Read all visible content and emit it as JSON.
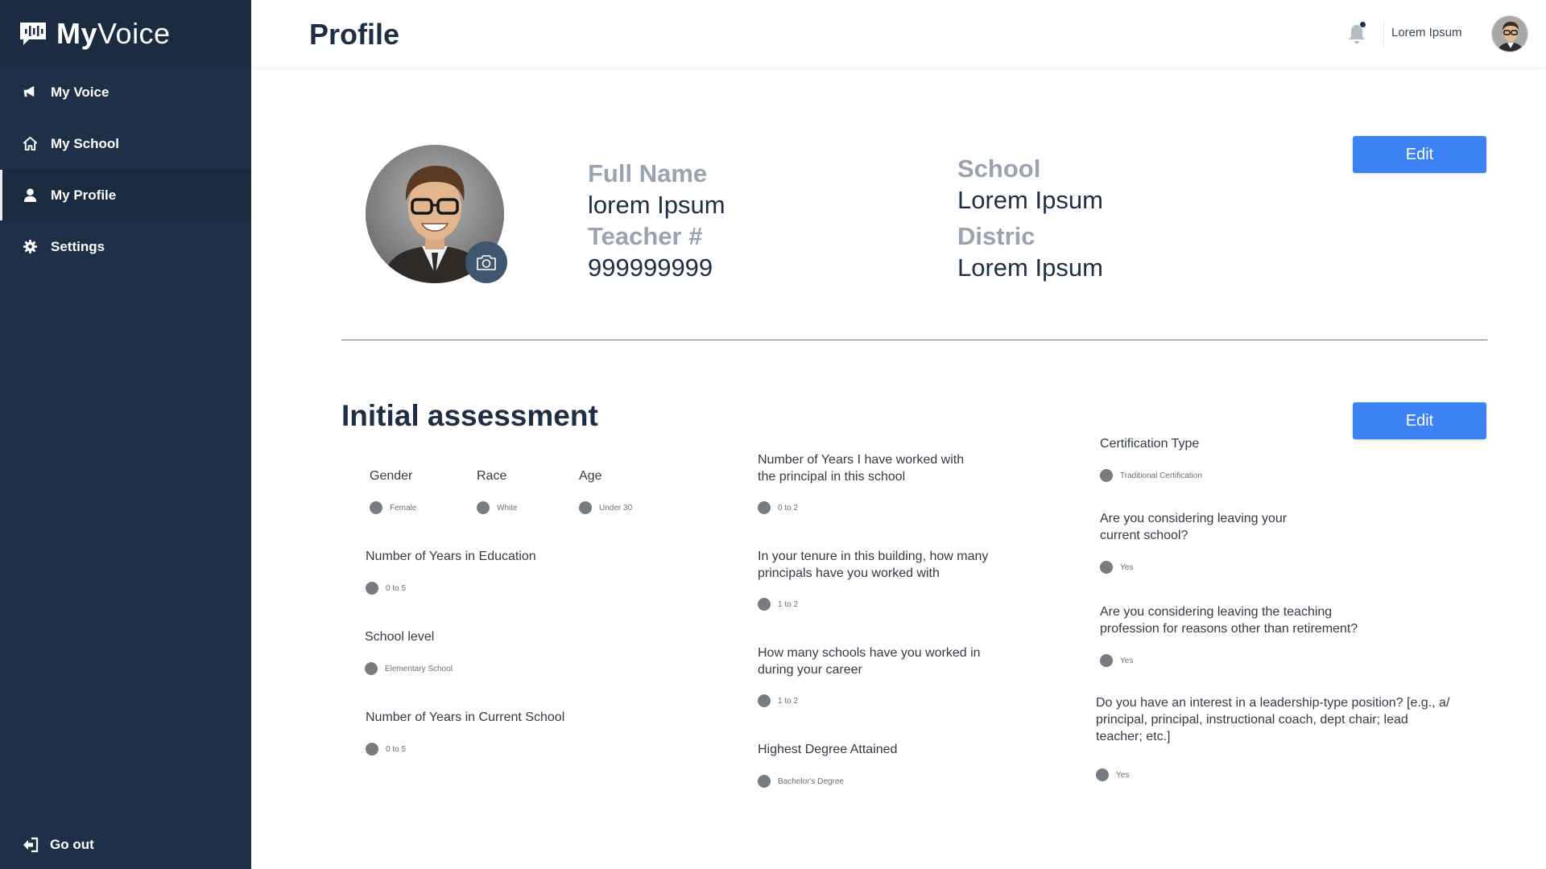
{
  "brand": {
    "bold": "My",
    "light": "Voice"
  },
  "nav": {
    "items": [
      {
        "label": "My Voice",
        "icon": "megaphone-icon"
      },
      {
        "label": "My School",
        "icon": "home-icon"
      },
      {
        "label": "My Profile",
        "icon": "user-icon",
        "active": true
      },
      {
        "label": "Settings",
        "icon": "gear-icon"
      }
    ],
    "go_out": "Go out"
  },
  "header": {
    "title": "Profile",
    "user_name": "Lorem Ipsum"
  },
  "profile": {
    "full_name_label": "Full Name",
    "full_name": "lorem Ipsum",
    "teacher_label": "Teacher #",
    "teacher_number": "999999999",
    "school_label": "School",
    "school": "Lorem Ipsum",
    "district_label": "Distric",
    "district": "Lorem Ipsum",
    "edit_label": "Edit"
  },
  "assessment": {
    "title": "Initial assessment",
    "edit_label": "Edit",
    "gender": {
      "question": "Gender",
      "answer": "Female"
    },
    "race": {
      "question": "Race",
      "answer": "White"
    },
    "age": {
      "question": "Age",
      "answer": "Under 30"
    },
    "years_education": {
      "question": "Number of Years in Education",
      "answer": "0 to 5"
    },
    "school_level": {
      "question": "School level",
      "answer": "Elementary School"
    },
    "years_current_school": {
      "question": "Number of Years in Current School",
      "answer": "0 to 5"
    },
    "years_with_principal": {
      "question_line1": "Number of Years I have worked with",
      "question_line2": "the principal in this school",
      "answer": "0 to 2"
    },
    "principals_count": {
      "question_line1": "In your tenure in this building, how many",
      "question_line2": "principals have you worked with",
      "answer": "1 to 2"
    },
    "schools_count": {
      "question_line1": "How many schools have you worked in",
      "question_line2": "during your career",
      "answer": "1 to 2"
    },
    "highest_degree": {
      "question": "Highest Degree Attained",
      "answer": "Bachelor's Degree"
    },
    "certification": {
      "question": "Certification Type",
      "answer": "Traditional Certification"
    },
    "leaving_school": {
      "question_line1": "Are you considering leaving your",
      "question_line2": "current school?",
      "answer": "Yes"
    },
    "leaving_profession": {
      "question_line1": "Are you considering leaving the teaching",
      "question_line2": "profession for reasons other than retirement?",
      "answer": "Yes"
    },
    "leadership": {
      "question_line1": "Do you have an interest in a leadership-type position? [e.g., a/",
      "question_line2": "principal, principal, instructional coach, dept chair; lead",
      "question_line3": "teacher; etc.]",
      "answer": "Yes"
    }
  },
  "colors": {
    "sidebar": "#1e3048",
    "accent": "#3d82f5",
    "label_gray": "#9aa4b1"
  }
}
